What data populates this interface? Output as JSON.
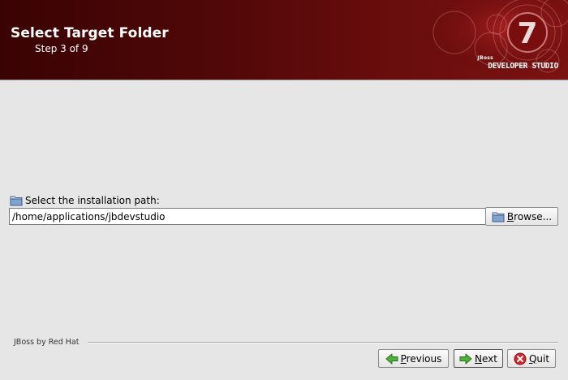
{
  "banner": {
    "title": "Select Target Folder",
    "step": "Step 3 of 9",
    "brand_small": "JBoss",
    "brand_big": "DEVELOPER STUDIO",
    "brand_numeral": "7"
  },
  "main": {
    "path_label": "Select the installation path:",
    "path_value": "/home/applications/jbdevstudio",
    "browse_mnemonic": "B",
    "browse_rest": "rowse..."
  },
  "footer": {
    "brand": "JBoss by Red Hat",
    "previous_mnemonic": "P",
    "previous_rest": "revious",
    "next_mnemonic": "N",
    "next_rest": "ext",
    "quit_mnemonic": "Q",
    "quit_rest": "uit"
  },
  "colors": {
    "banner_dark": "#3a0303",
    "banner_light": "#7c1212",
    "background": "#e6e6e6",
    "arrow_green": "#3a9a2a",
    "quit_red": "#c8161b"
  }
}
